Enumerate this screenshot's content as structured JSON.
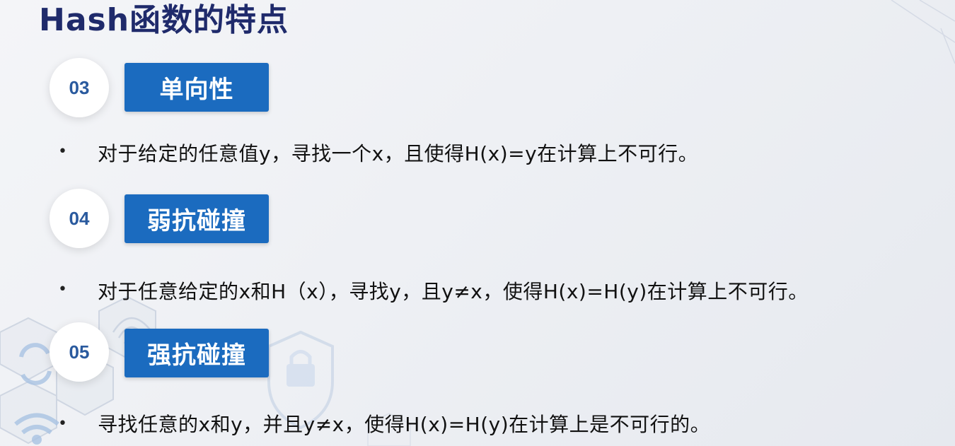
{
  "slide": {
    "title": "Hash函数的特点",
    "items": [
      {
        "number": "03",
        "heading": "单向性",
        "text": "对于给定的任意值y，寻找一个x，且使得H(x)=y在计算上不可行。"
      },
      {
        "number": "04",
        "heading": "弱抗碰撞",
        "text": "对于任意给定的x和H（x），寻找y，且y≠x，使得H(x)=H(y)在计算上不可行。"
      },
      {
        "number": "05",
        "heading": "强抗碰撞",
        "text": "寻找任意的x和y，并且y≠x，使得H(x)=H(y)在计算上是不可行的。"
      }
    ],
    "bullet_glyph": "•",
    "decorations": [
      "hexagon-pattern",
      "refresh-icon",
      "wifi-icon",
      "shield-lock-icon",
      "fingerprint-icon"
    ],
    "colors": {
      "title": "#1f2a6b",
      "tag_bg": "#1b6bbf",
      "badge_text": "#2a5a9e"
    }
  }
}
